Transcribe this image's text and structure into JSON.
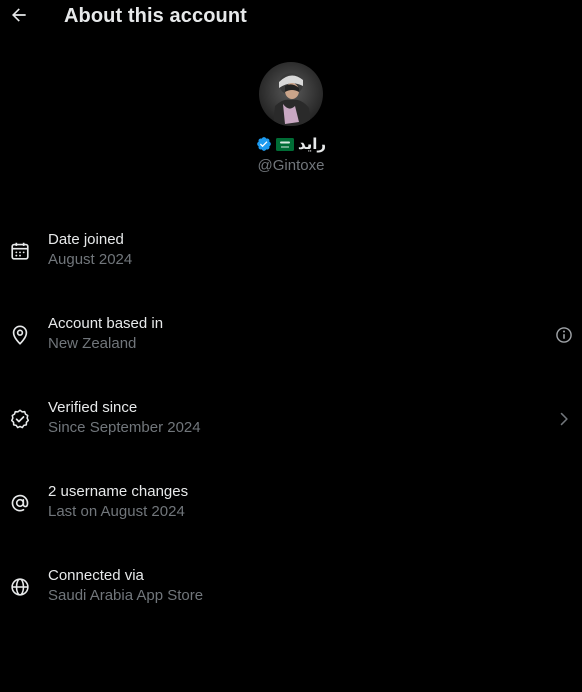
{
  "header": {
    "title": "About this account",
    "back_icon": "arrow-left-icon"
  },
  "profile": {
    "display_name": "رايد",
    "flag_icon": "saudi-arabia-flag-icon",
    "verified_icon": "verified-badge-icon",
    "handle": "@Gintoxe"
  },
  "details": [
    {
      "icon": "calendar-icon",
      "label": "Date joined",
      "value": "August 2024"
    },
    {
      "icon": "location-pin-icon",
      "label": "Account based in",
      "value": "New Zealand",
      "trailing_icon": "info-icon"
    },
    {
      "icon": "verified-check-icon",
      "label": "Verified since",
      "value": "Since September 2024",
      "trailing_icon": "chevron-right-icon"
    },
    {
      "icon": "at-sign-icon",
      "label": "2 username changes",
      "value": "Last on August 2024"
    },
    {
      "icon": "globe-icon",
      "label": "Connected via",
      "value": "Saudi Arabia App Store"
    }
  ],
  "colors": {
    "background": "#000000",
    "primary_text": "#e7e9ea",
    "secondary_text": "#71767b",
    "verified_blue": "#1d9bf0",
    "flag_green": "#006c35"
  }
}
